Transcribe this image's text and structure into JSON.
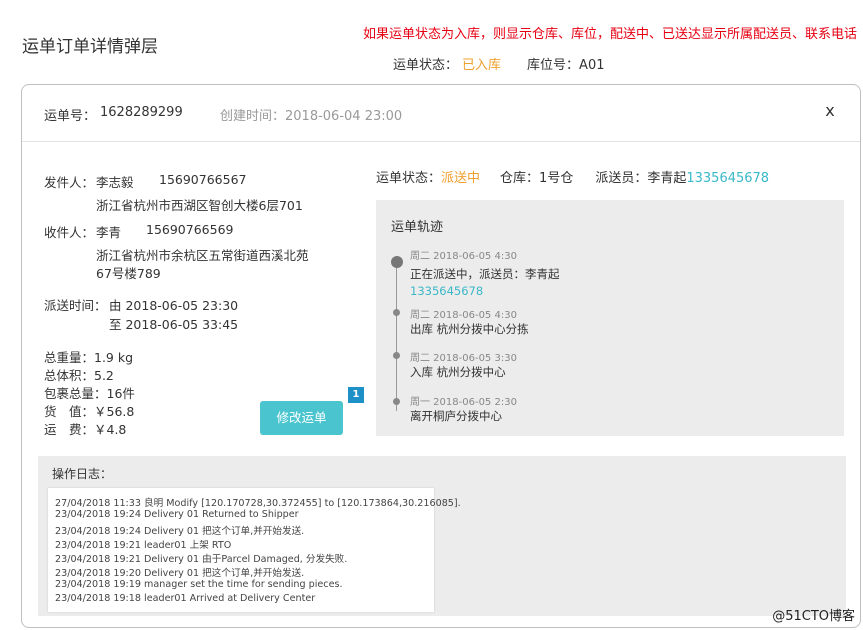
{
  "page_title": "运单订单详情弹层",
  "note": "如果运单状态为入库，则显示仓库、库位，配送中、已送达显示所属配送员、联系电话",
  "status_line": {
    "status_label": "运单状态：",
    "status_value": "已入库",
    "location_label": "库位号：",
    "location_value": "A01"
  },
  "modal": {
    "order_label": "运单号：",
    "order_no": "1628289299",
    "created_label": "创建时间：",
    "created_value": "2018-06-04 23:00",
    "close": "x"
  },
  "sender": {
    "label": "发件人：",
    "name": "李志毅",
    "phone": "15690766567",
    "address": "浙江省杭州市西湖区智创大楼6层701"
  },
  "receiver": {
    "label": "收件人：",
    "name": "李青",
    "phone": "15690766569",
    "address_line1": "浙江省杭州市余杭区五常街道西溪北苑",
    "address_line2": "67号楼789"
  },
  "delivery_time": {
    "label": "派送时间：",
    "from": "由 2018-06-05 23:30",
    "to": "至 2018-06-05 33:45"
  },
  "package": {
    "weight": "总重量：1.9 kg",
    "volume": "总体积：5.2",
    "count": "包裹总量：16件",
    "value": "货　值：￥56.8",
    "fee": "运　费：￥4.8"
  },
  "waybill": {
    "status_label": "运单状态：",
    "status_value": "派送中",
    "warehouse_label": "仓库：",
    "warehouse_value": "1号仓",
    "courier_label": "派送员：",
    "courier_name": "李青起",
    "courier_phone": "1335645678"
  },
  "track": {
    "title": "运单轨迹",
    "events": [
      {
        "time": "周二 2018-06-05 4:30",
        "text": "正在派送中，派送员：李青起",
        "phone": "1335645678"
      },
      {
        "time": "周二 2018-06-05 4:30",
        "text": "出库 杭州分拨中心分拣"
      },
      {
        "time": "周二 2018-06-05 3:30",
        "text": "入库 杭州分拨中心"
      },
      {
        "time": "周一  2018-06-05 2:30",
        "text": "离开桐庐分拨中心"
      }
    ]
  },
  "edit_button": "修改运单",
  "badge": "1",
  "log": {
    "title": "操作日志：",
    "lines": [
      "27/04/2018 11:33 良明 Modify [120.170728,30.372455] to [120.173864,30.216085].",
      "23/04/2018 19:24 Delivery 01 Returned to Shipper",
      "23/04/2018 19:24 Delivery 01 把这个订单,并开始发送.",
      "23/04/2018 19:21 leader01 上架 RTO",
      "23/04/2018 19:21 Delivery 01 由于Parcel Damaged, 分发失败.",
      "23/04/2018 19:20 Delivery 01 把这个订单,并开始发送.",
      "23/04/2018 19:19 manager set the time for sending pieces.",
      "23/04/2018 19:18 leader01 Arrived at Delivery Center"
    ]
  },
  "watermark": "@51CTO博客",
  "colors": {
    "accent_teal": "#4ac5cf",
    "status_orange": "#f0a030",
    "note_red": "#e60012",
    "phone_teal": "#3ab8c8",
    "badge_blue": "#1e90c8"
  }
}
